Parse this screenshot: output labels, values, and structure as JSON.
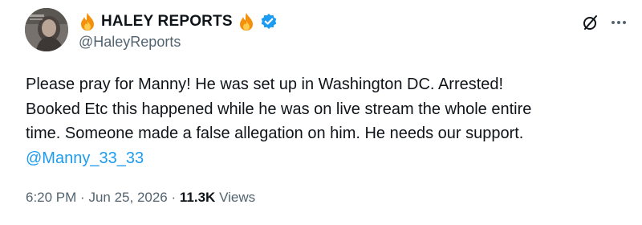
{
  "author": {
    "display_name": "HALEY REPORTS",
    "handle": "@HaleyReports",
    "verified": true,
    "name_emoji": "flame-emoji",
    "verified_color": "#1d9bf0"
  },
  "actions": {
    "grok_icon": "grok-slash-circle-icon",
    "more_icon": "more-dots-icon"
  },
  "tweet": {
    "lines": [
      "Please pray for Manny! He was set up in Washington DC. Arrested!",
      "Booked Etc this happened while he was on live stream the whole entire",
      "time. Someone made a false allegation on him. He needs our support."
    ],
    "mention": "@Manny_33_33",
    "mention_color": "#1d9bf0"
  },
  "meta": {
    "time": "6:20 PM",
    "separator": "·",
    "date": "Jun 25, 2026",
    "views_count": "11.3K",
    "views_label": "Views"
  }
}
